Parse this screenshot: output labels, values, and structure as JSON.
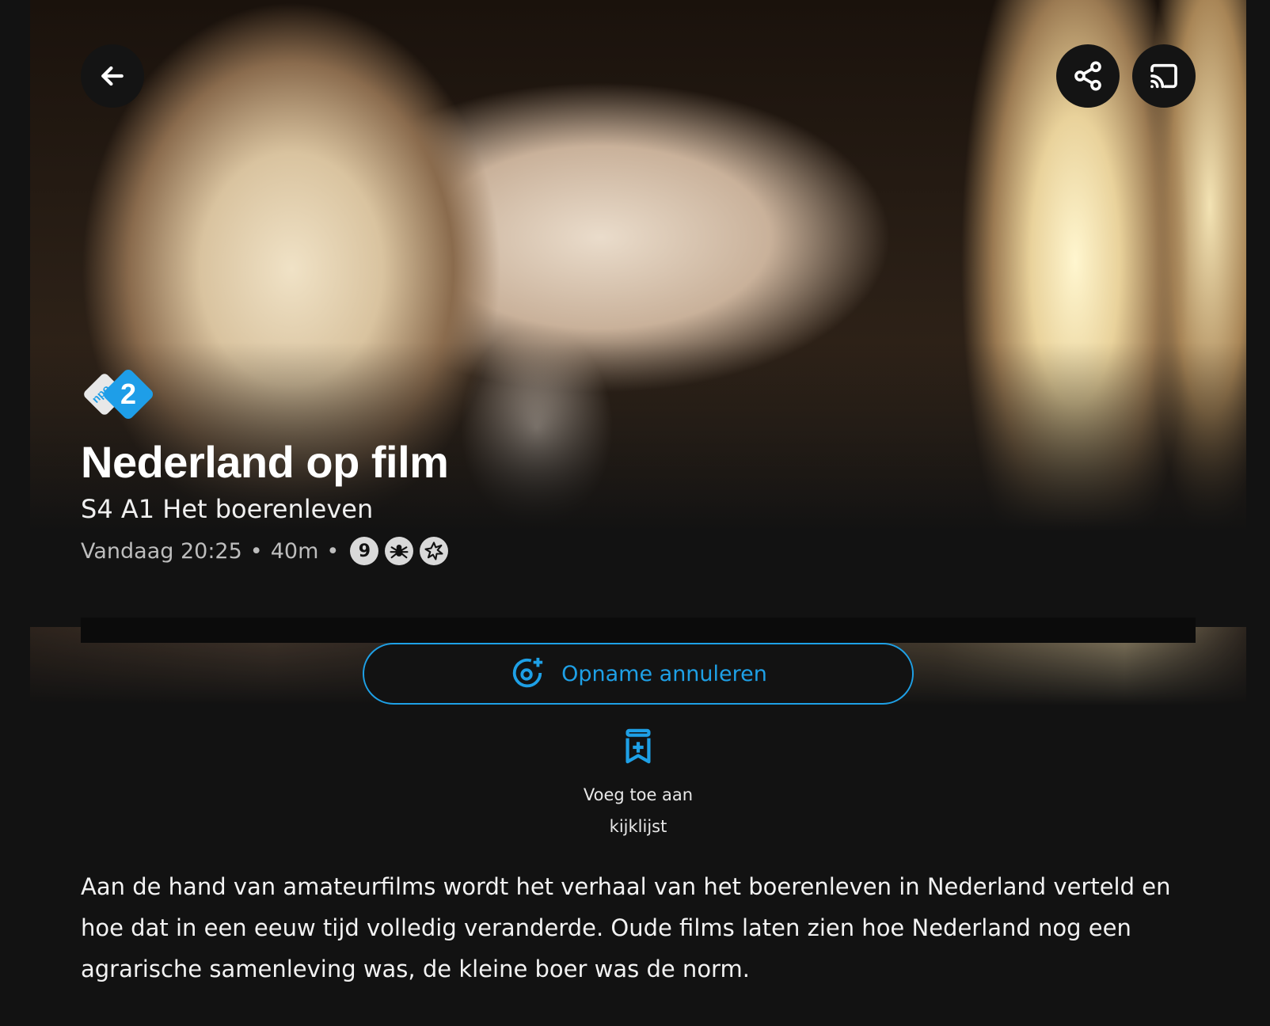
{
  "header": {
    "back_icon": "arrow-left-icon",
    "share_icon": "share-icon",
    "cast_icon": "cast-icon"
  },
  "program": {
    "channel_logo": "npo-2",
    "title": "Nederland op film",
    "episode": "S4 A1 Het boerenleven",
    "time": "Vandaag 20:25",
    "separator": "•",
    "duration": "40m",
    "ratings": [
      {
        "icon": "age-9-icon",
        "label": "9"
      },
      {
        "icon": "fear-icon"
      },
      {
        "icon": "violence-icon"
      }
    ]
  },
  "actions": {
    "record_label": "Opname annuleren",
    "record_icon": "record-cancel-icon",
    "watchlist_line1": "Voeg toe aan",
    "watchlist_line2": "kijklijst",
    "watchlist_icon": "bookmark-add-icon"
  },
  "description": "Aan de hand van amateurfilms wordt het verhaal van het boerenleven in Nederland verteld en hoe dat in een eeuw tijd volledig veranderde. Oude films laten zien hoe Nederland nog een agrarische samenleving was, de kleine boer was de norm.",
  "colors": {
    "accent": "#1ea0e6",
    "background": "#121212"
  }
}
